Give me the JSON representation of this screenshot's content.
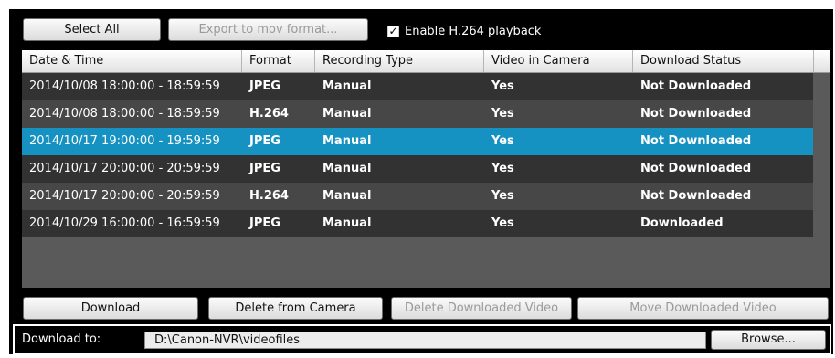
{
  "toolbar": {
    "select_all": "Select All",
    "export": "Export to mov format...",
    "enable_h264_label": "Enable H.264 playback",
    "enable_h264_checked": true
  },
  "table": {
    "headers": [
      "Date & Time",
      "Format",
      "Recording Type",
      "Video in Camera",
      "Download Status"
    ],
    "rows": [
      {
        "date_time": "2014/10/08 18:00:00 - 18:59:59",
        "format": "JPEG",
        "recording_type": "Manual",
        "video_in_camera": "Yes",
        "download_status": "Not Downloaded",
        "selected": false
      },
      {
        "date_time": "2014/10/08 18:00:00 - 18:59:59",
        "format": "H.264",
        "recording_type": "Manual",
        "video_in_camera": "Yes",
        "download_status": "Not Downloaded",
        "selected": false
      },
      {
        "date_time": "2014/10/17 19:00:00 - 19:59:59",
        "format": "JPEG",
        "recording_type": "Manual",
        "video_in_camera": "Yes",
        "download_status": "Not Downloaded",
        "selected": true
      },
      {
        "date_time": "2014/10/17 20:00:00 - 20:59:59",
        "format": "JPEG",
        "recording_type": "Manual",
        "video_in_camera": "Yes",
        "download_status": "Not Downloaded",
        "selected": false
      },
      {
        "date_time": "2014/10/17 20:00:00 - 20:59:59",
        "format": "H.264",
        "recording_type": "Manual",
        "video_in_camera": "Yes",
        "download_status": "Not Downloaded",
        "selected": false
      },
      {
        "date_time": "2014/10/29 16:00:00 - 16:59:59",
        "format": "JPEG",
        "recording_type": "Manual",
        "video_in_camera": "Yes",
        "download_status": "Downloaded",
        "selected": false
      }
    ]
  },
  "actions": {
    "download": "Download",
    "delete_from_camera": "Delete from Camera",
    "delete_downloaded": "Delete Downloaded Video",
    "move_downloaded": "Move Downloaded Video"
  },
  "download_to": {
    "label": "Download to:",
    "path": "D:\\Canon-NVR\\videofiles",
    "browse": "Browse..."
  },
  "colors": {
    "selected_row": "#1592c2",
    "background": "#000000"
  }
}
